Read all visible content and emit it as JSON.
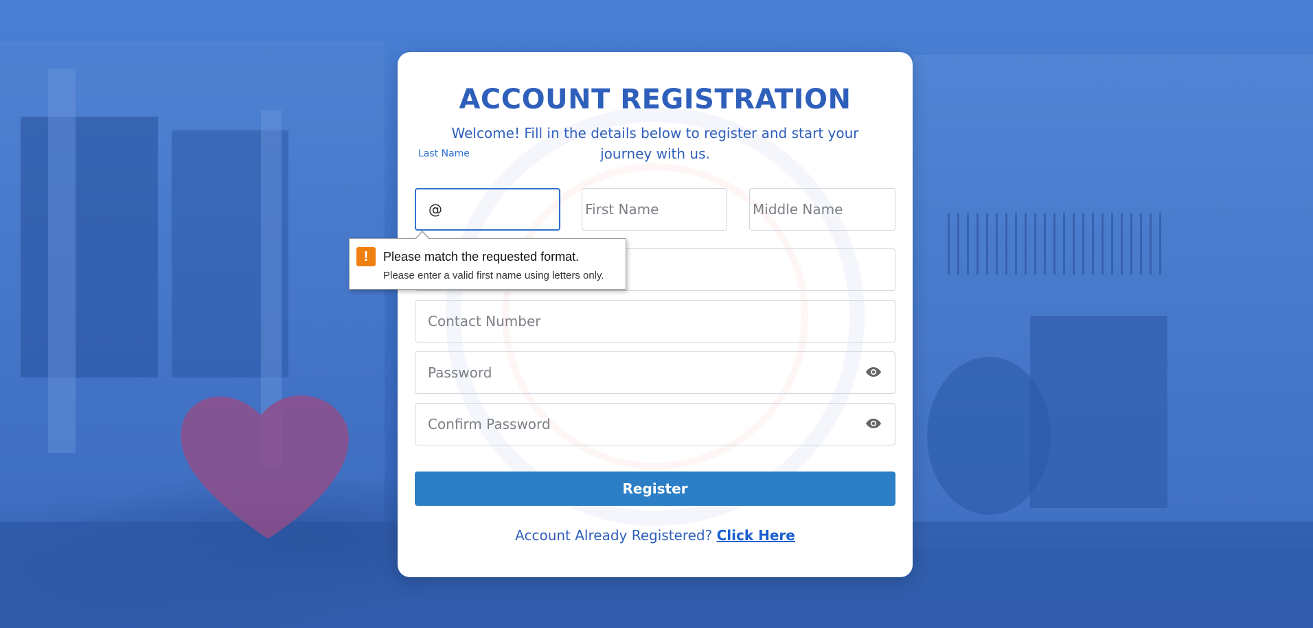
{
  "form": {
    "title": "ACCOUNT REGISTRATION",
    "subtitle": "Welcome! Fill in the details below to register and start your journey with us.",
    "last_name": {
      "label": "Last Name",
      "value": "@"
    },
    "first_name": {
      "placeholder": "First Name"
    },
    "middle_name": {
      "placeholder": "Middle Name"
    },
    "contact_number": {
      "placeholder": "Contact Number"
    },
    "password": {
      "placeholder": "Password"
    },
    "confirm_password": {
      "placeholder": "Confirm Password"
    },
    "register_label": "Register",
    "login_prompt": "Account Already Registered?",
    "login_link": "Click Here"
  },
  "validation_tooltip": {
    "title": "Please match the requested format.",
    "message": "Please enter a valid first name using letters only."
  },
  "colors": {
    "primary": "#2e5fbb",
    "button": "#2c7fc6",
    "focus": "#2e6fd0",
    "warning": "#f07f12"
  }
}
